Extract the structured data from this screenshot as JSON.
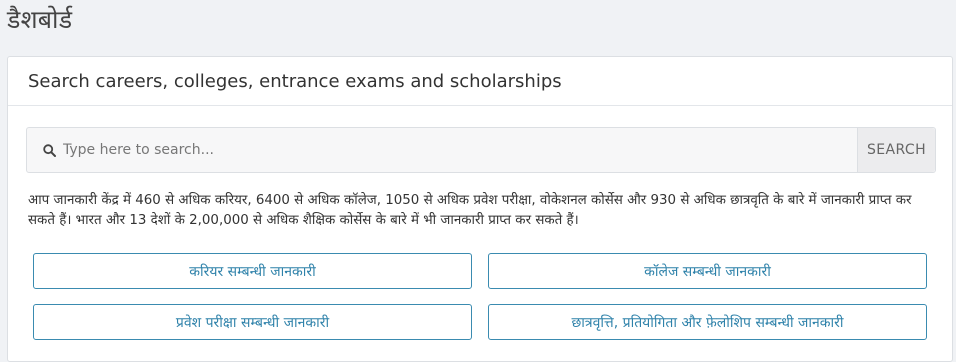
{
  "page": {
    "title": "डैशबोर्ड"
  },
  "card": {
    "heading": "Search careers, colleges, entrance exams and scholarships"
  },
  "search": {
    "placeholder": "Type here to search...",
    "value": "",
    "button_label": "SEARCH",
    "icon": "search-icon"
  },
  "info": {
    "text": "आप जानकारी केंद्र में 460 से अधिक करियर, 6400 से अधिक कॉलेज, 1050 से अधिक प्रवेश परीक्षा, वोकेशनल कोर्सेस और 930 से अधिक छात्रवृति के बारे में जानकारी प्राप्त कर सकते हैं। भारत और 13 देशों के 2,00,000 से अधिक शैक्षिक कोर्सेस के बारे में भी जानकारी प्राप्त कर सकते हैं।"
  },
  "links": [
    {
      "label": "करियर सम्बन्धी जानकारी"
    },
    {
      "label": "कॉलेज सम्बन्धी जानकारी"
    },
    {
      "label": "प्रवेश परीक्षा सम्बन्धी जानकारी"
    },
    {
      "label": "छात्रवृत्ति, प्रतियोगिता और फ़ेलोशिप सम्बन्धी जानकारी"
    }
  ],
  "colors": {
    "accent": "#2f82aa",
    "border": "#3a8bb0",
    "background": "#f0f2f5"
  }
}
